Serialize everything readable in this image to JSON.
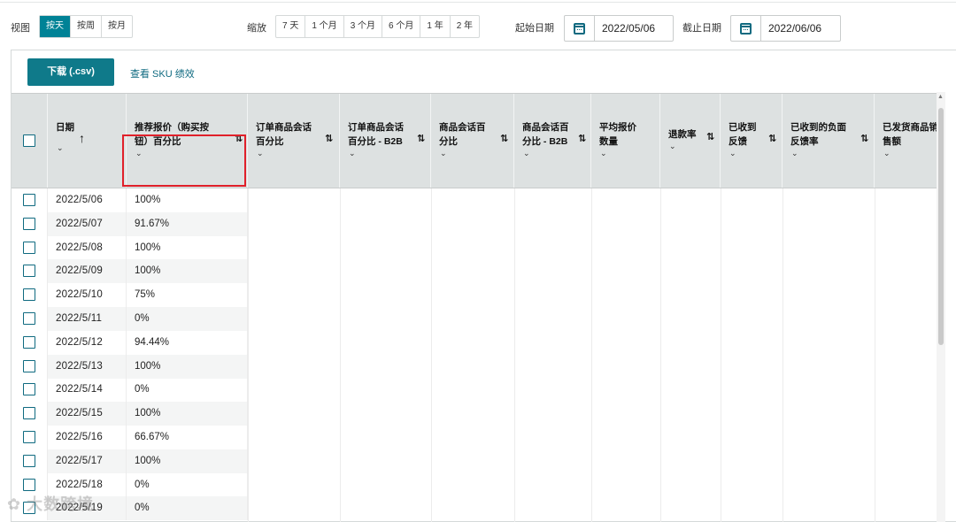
{
  "toolbar": {
    "view_label": "视图",
    "view_options": [
      "按天",
      "按周",
      "按月"
    ],
    "zoom_label": "缩放",
    "zoom_options": [
      "7 天",
      "1 个月",
      "3 个月",
      "6 个月",
      "1 年",
      "2 年"
    ],
    "start_label": "起始日期",
    "start_date": "2022/05/06",
    "end_label": "截止日期",
    "end_date": "2022/06/06"
  },
  "actions": {
    "download_label": "下载 (.csv)",
    "sku_link": "查看 SKU 绩效"
  },
  "columns": [
    {
      "label": "日期"
    },
    {
      "label": "推荐报价（购买按\n钮）百分比"
    },
    {
      "label": "订单商品会话\n百分比"
    },
    {
      "label": "订单商品会话\n百分比 - B2B"
    },
    {
      "label": "商品会话百\n分比"
    },
    {
      "label": "商品会话百\n分比 - B2B"
    },
    {
      "label": "平均报价\n数量"
    },
    {
      "label": "退款率"
    },
    {
      "label": "已收到\n反馈"
    },
    {
      "label": "已收到的负面\n反馈率"
    },
    {
      "label": "已发货商品销\n售额"
    }
  ],
  "rows": [
    {
      "date": "2022/5/06",
      "value": "100%"
    },
    {
      "date": "2022/5/07",
      "value": "91.67%"
    },
    {
      "date": "2022/5/08",
      "value": "100%"
    },
    {
      "date": "2022/5/09",
      "value": "100%"
    },
    {
      "date": "2022/5/10",
      "value": "75%"
    },
    {
      "date": "2022/5/11",
      "value": "0%"
    },
    {
      "date": "2022/5/12",
      "value": "94.44%"
    },
    {
      "date": "2022/5/13",
      "value": "100%"
    },
    {
      "date": "2022/5/14",
      "value": "0%"
    },
    {
      "date": "2022/5/15",
      "value": "100%"
    },
    {
      "date": "2022/5/16",
      "value": "66.67%"
    },
    {
      "date": "2022/5/17",
      "value": "100%"
    },
    {
      "date": "2022/5/18",
      "value": "0%"
    },
    {
      "date": "2022/5/19",
      "value": "0%"
    }
  ],
  "watermark": "大数跨境",
  "colors": {
    "accent": "#008296",
    "highlight": "#e0202a",
    "header_bg": "#dde1e1"
  },
  "icons": {
    "calendar": "calendar-icon",
    "sort": "sort-icon",
    "chevron": "chevron-down-icon",
    "sort_asc": "arrow-up-icon"
  }
}
